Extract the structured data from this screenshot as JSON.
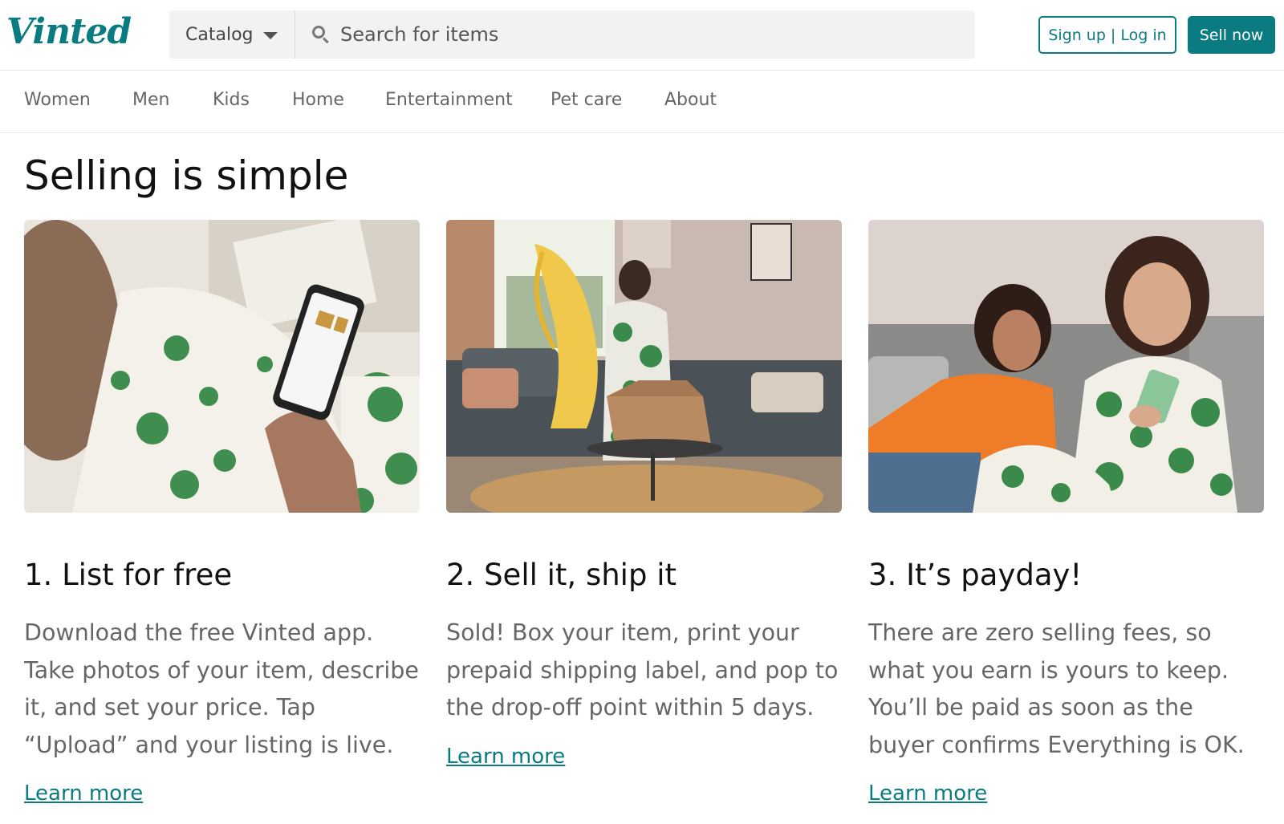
{
  "header": {
    "logo_text": "Vinted",
    "catalog_label": "Catalog",
    "search_placeholder": "Search for items",
    "signup_label": "Sign up | Log in",
    "sell_label": "Sell now"
  },
  "nav": {
    "items": [
      "Women",
      "Men",
      "Kids",
      "Home",
      "Entertainment",
      "Pet care",
      "About"
    ]
  },
  "main": {
    "title": "Selling is simple",
    "steps": [
      {
        "title": "1. List for free",
        "text": "Download the free Vinted app. Take photos of your item, describe it, and set your price. Tap “Upload” and your listing is live.",
        "link": "Learn more"
      },
      {
        "title": "2. Sell it, ship it",
        "text": "Sold! Box your item, print your prepaid shipping label, and pop to the drop-off point within 5 days.",
        "link": "Learn more"
      },
      {
        "title": "3. It’s payday!",
        "text": "There are zero selling fees, so what you earn is yours to keep. You’ll be paid as soon as the buyer confirms Everything is OK.",
        "link": "Learn more"
      }
    ]
  },
  "colors": {
    "brand": "#0a7b80",
    "text_muted": "#666666"
  }
}
